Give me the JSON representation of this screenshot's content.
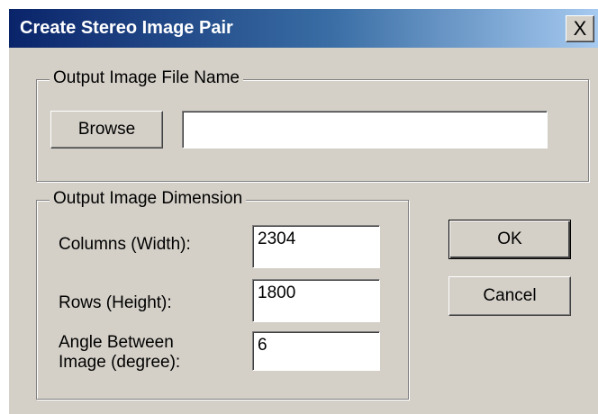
{
  "window": {
    "title": "Create Stereo Image Pair",
    "close_symbol": "X"
  },
  "output_file": {
    "legend": "Output Image File Name",
    "browse_label": "Browse",
    "file_name_value": ""
  },
  "dimension": {
    "legend": "Output Image Dimension",
    "columns_label": "Columns (Width):",
    "columns_value": "2304",
    "rows_label": "Rows (Height):",
    "rows_value": "1800",
    "angle_label_line1": "Angle Between",
    "angle_label_line2": "Image (degree):",
    "angle_value": "6"
  },
  "buttons": {
    "ok_label": "OK",
    "cancel_label": "Cancel"
  },
  "colors": {
    "dialog_face": "#d4d0c8",
    "title_bar_start": "#0a246a",
    "title_bar_end": "#a6caf0"
  }
}
